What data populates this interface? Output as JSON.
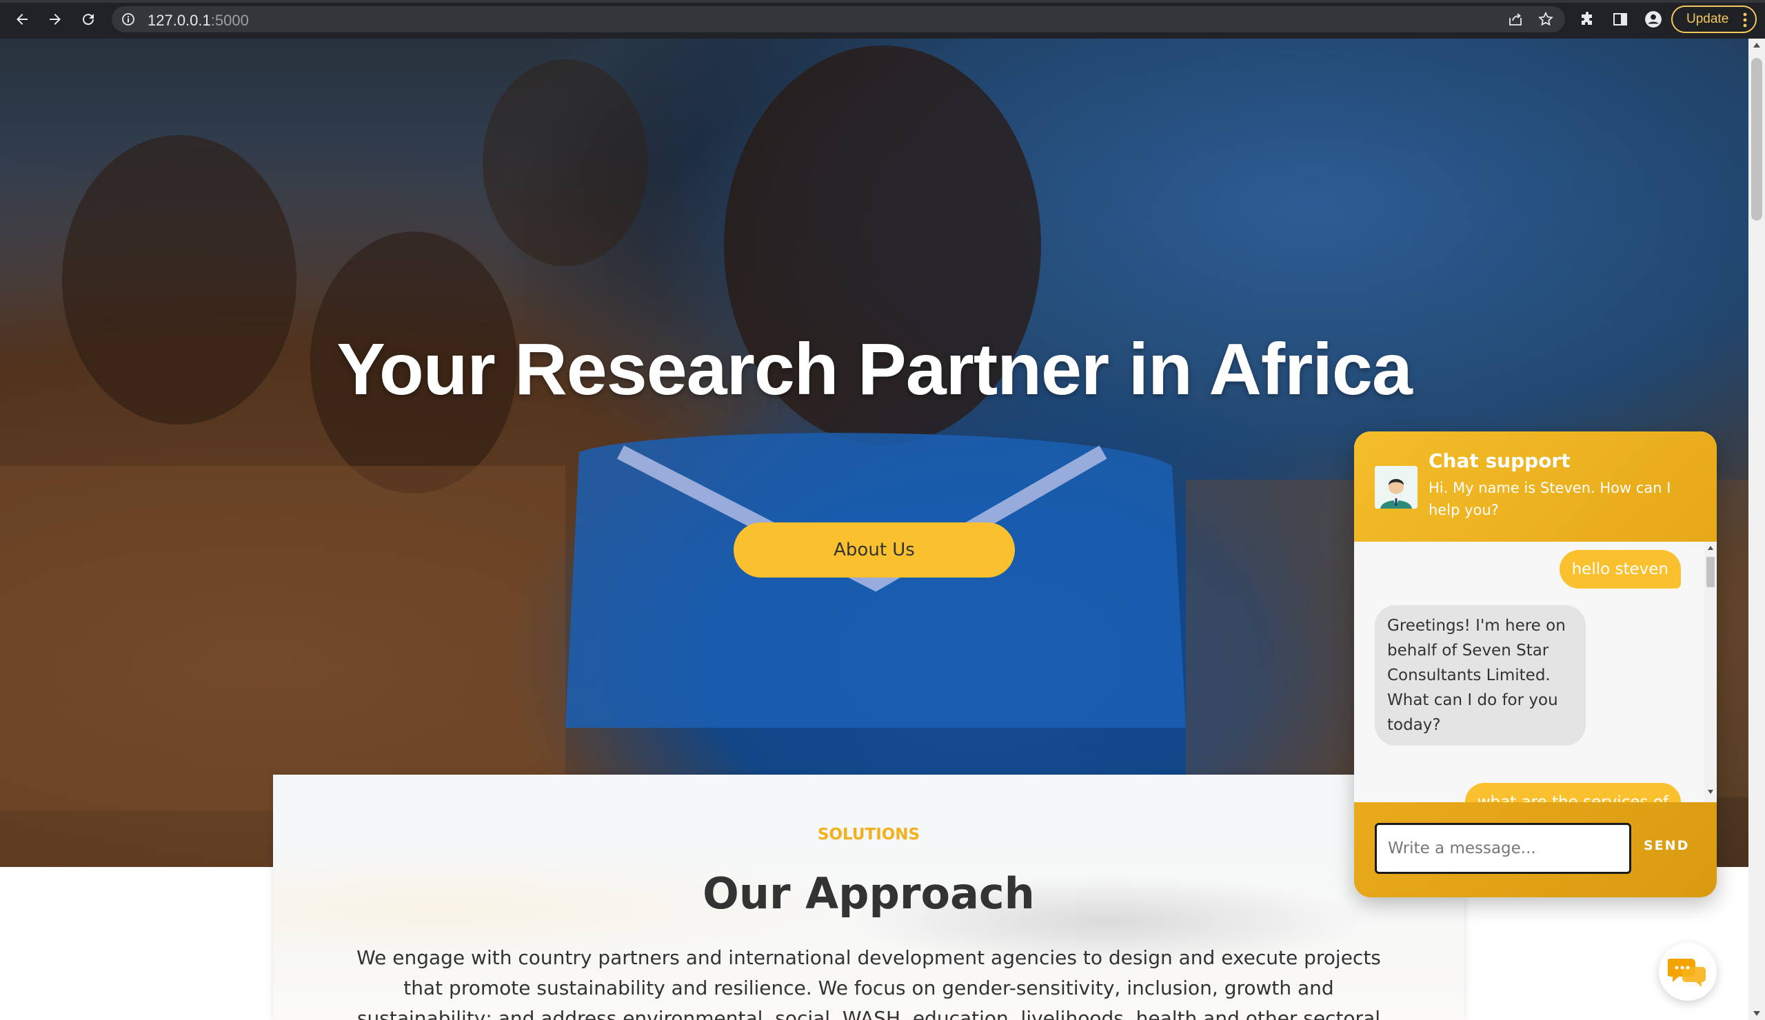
{
  "browser": {
    "url_host": "127.0.0.1",
    "url_port": ":5000",
    "update_label": "Update"
  },
  "hero": {
    "title": "Your Research Partner in Africa",
    "cta_label": "About Us"
  },
  "approach": {
    "eyebrow": "SOLUTIONS",
    "heading": "Our Approach",
    "text": "We engage with country partners and international development agencies to design and execute projects that promote sustainability and resilience. We focus on gender-sensitivity, inclusion, growth and sustainability; and address environmental, social, WASH, education, livelihoods, health and other sectoral needs in developing"
  },
  "chat": {
    "title": "Chat support",
    "subtitle": "Hi. My name is Steven. How can I help you?",
    "messages": [
      {
        "from": "user",
        "text": "hello steven"
      },
      {
        "from": "bot",
        "text": "Greetings! I'm here on behalf of Seven Star Consultants Limited. What can I do for you today?"
      },
      {
        "from": "user",
        "text": "what are the services of"
      }
    ],
    "input_placeholder": "Write a message...",
    "send_label": "SEND"
  },
  "colors": {
    "accent": "#fbc02d",
    "chat_header": "#f4bd2a",
    "text_dark": "#333333"
  },
  "icons": [
    "back-icon",
    "forward-icon",
    "reload-icon",
    "info-icon",
    "share-icon",
    "star-icon",
    "puzzle-icon",
    "sidepanel-icon",
    "profile-icon",
    "kebab-icon",
    "chat-bubbles-icon",
    "support-avatar-icon"
  ]
}
